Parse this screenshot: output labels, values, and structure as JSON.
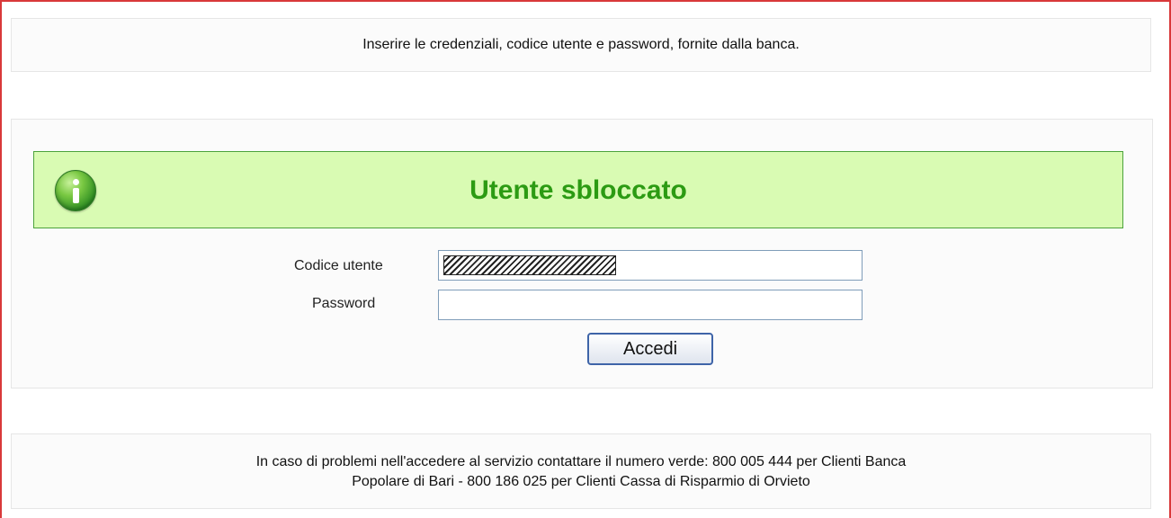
{
  "instructions": {
    "text": "Inserire le credenziali, codice utente e password, fornite dalla banca."
  },
  "message": {
    "icon": "info-icon",
    "title": "Utente sbloccato",
    "colors": {
      "background": "#d9fbb3",
      "border": "#4ca23c",
      "text": "#2c9b13"
    }
  },
  "login": {
    "user_label": "Codice utente",
    "user_value": "",
    "password_label": "Password",
    "password_value": "",
    "submit_label": "Accedi"
  },
  "help": {
    "line1": "In caso di problemi nell'accedere al servizio contattare il numero verde: 800 005 444 per Clienti Banca",
    "line2": "Popolare di Bari - 800 186 025 per Clienti Cassa di Risparmio di Orvieto"
  }
}
